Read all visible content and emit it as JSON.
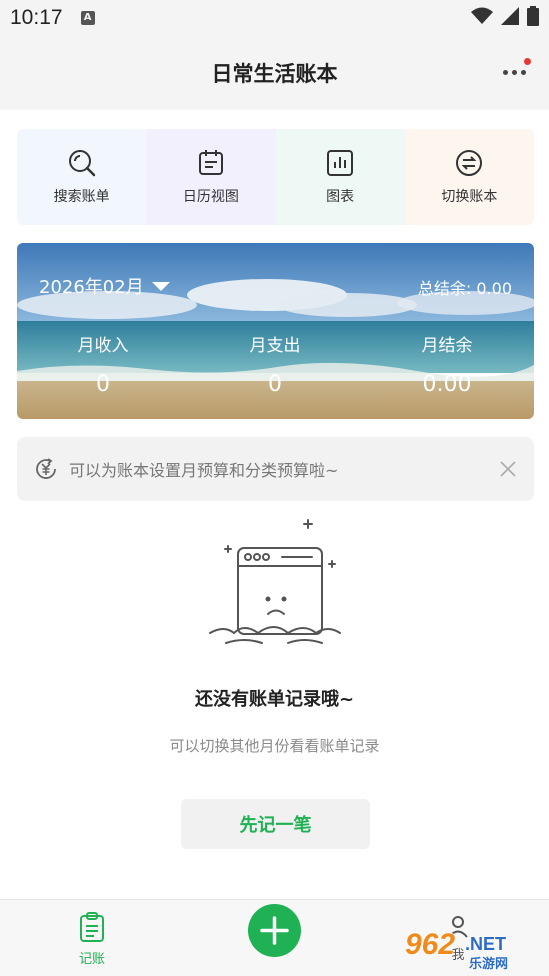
{
  "status_bar": {
    "time": "10:17",
    "a_badge": "A"
  },
  "header": {
    "title": "日常生活账本"
  },
  "quick_actions": [
    {
      "label": "搜索账单",
      "icon": "search-icon",
      "bg": "#f2f6fd"
    },
    {
      "label": "日历视图",
      "icon": "calendar-icon",
      "bg": "#f1f0fc"
    },
    {
      "label": "图表",
      "icon": "chart-icon",
      "bg": "#eef8f4"
    },
    {
      "label": "切换账本",
      "icon": "switch-icon",
      "bg": "#fdf6ef"
    }
  ],
  "summary": {
    "month": "2026年02月",
    "total_balance_label": "总结余: 0.00",
    "income_label": "月收入",
    "income_value": "0",
    "expense_label": "月支出",
    "expense_value": "0",
    "balance_label": "月结余",
    "balance_value": "0.00"
  },
  "budget_tip": {
    "text": "可以为账本设置月预算和分类预算啦~",
    "icon": "yen-cycle-icon"
  },
  "empty_state": {
    "title": "还没有账单记录哦~",
    "subtitle": "可以切换其他月份看看账单记录",
    "button_label": "先记一笔"
  },
  "bottom_nav": {
    "book_label": "记账",
    "mine_label": "我"
  },
  "watermark": {
    "brand": "962",
    "suffix": ".NET",
    "sub": "乐游网"
  },
  "colors": {
    "accent": "#1fb153",
    "notification": "#e53935"
  }
}
